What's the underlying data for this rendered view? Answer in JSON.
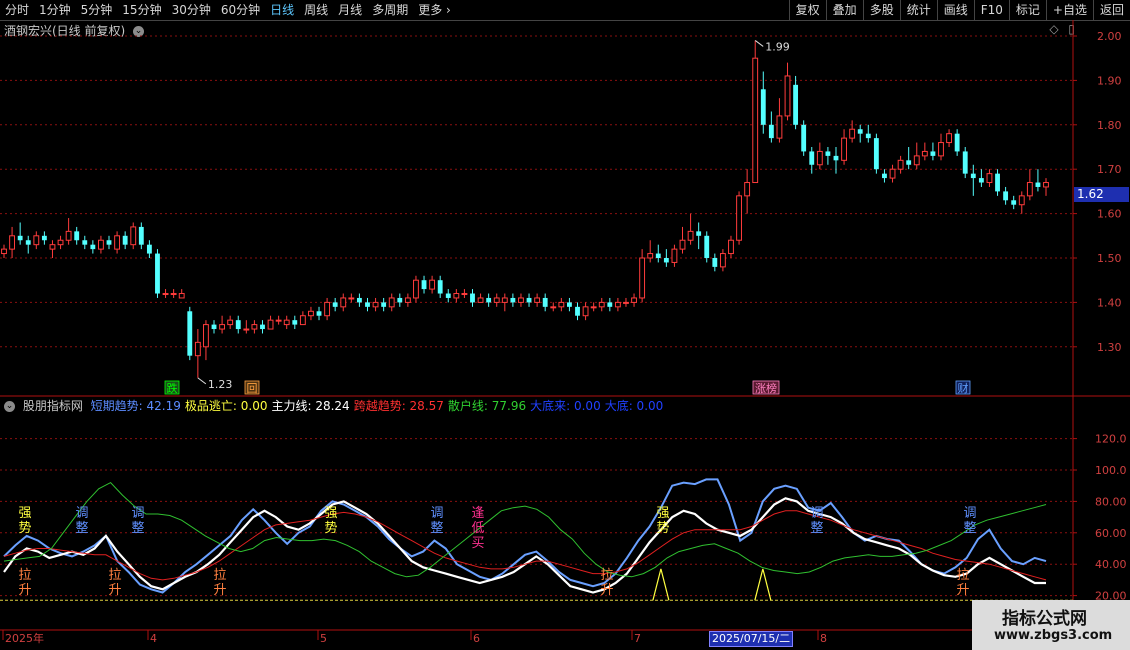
{
  "toolbar": {
    "periods": [
      "分时",
      "1分钟",
      "5分钟",
      "15分钟",
      "30分钟",
      "60分钟",
      "日线",
      "周线",
      "月线",
      "多周期",
      "更多"
    ],
    "active_period": "日线",
    "actions": [
      "复权",
      "叠加",
      "多股",
      "统计",
      "画线",
      "F10",
      "标记",
      "+自选",
      "返回"
    ]
  },
  "stock": {
    "title": "酒钢宏兴(日线 前复权)",
    "current_price": "1.62",
    "high_label": "1.99",
    "low_label": "1.23"
  },
  "price_axis": [
    "2.00",
    "1.90",
    "1.80",
    "1.70",
    "1.60",
    "1.50",
    "1.40",
    "1.30"
  ],
  "indicator_axis": [
    "120.0",
    "100.0",
    "80.00",
    "60.00",
    "40.00",
    "20.00"
  ],
  "event_markers": [
    {
      "text": "跌",
      "color": "#00ff00",
      "bg": "#1a4d1a"
    },
    {
      "text": "回",
      "color": "#ffa040",
      "bg": "#4d3311"
    },
    {
      "text": "涨榜",
      "color": "#ff80c0",
      "bg": "#5a1a30"
    },
    {
      "text": "财",
      "color": "#60a0ff",
      "bg": "#10205a"
    }
  ],
  "indicator": {
    "name": "股朋指标网",
    "items": [
      {
        "label": "短期趋势:",
        "value": "42.19",
        "color": "#5c8cff"
      },
      {
        "label": "极品逃亡:",
        "value": "0.00",
        "color": "#ffff40"
      },
      {
        "label": "主力线:",
        "value": "28.24",
        "color": "#ffffff"
      },
      {
        "label": "跨越趋势:",
        "value": "28.57",
        "color": "#ff3030"
      },
      {
        "label": "散户线:",
        "value": "77.96",
        "color": "#30d030"
      },
      {
        "label": "大底来:",
        "value": "0.00",
        "color": "#2040ff"
      },
      {
        "label": "大底:",
        "value": "0.00",
        "color": "#2040ff"
      }
    ]
  },
  "signals": [
    {
      "text": "强",
      "text2": "势",
      "color": "#ffff40",
      "x": 25,
      "y": 517
    },
    {
      "text": "调",
      "text2": "整",
      "color": "#6090ff",
      "x": 82,
      "y": 517
    },
    {
      "text": "调",
      "text2": "整",
      "color": "#6090ff",
      "x": 138,
      "y": 517
    },
    {
      "text": "强",
      "text2": "势",
      "color": "#ffff40",
      "x": 331,
      "y": 517
    },
    {
      "text": "调",
      "text2": "整",
      "color": "#6090ff",
      "x": 437,
      "y": 517
    },
    {
      "text": "逢",
      "text2": "低",
      "text3": "买",
      "color": "#ff3090",
      "x": 478,
      "y": 517
    },
    {
      "text": "强",
      "text2": "势",
      "color": "#ffff40",
      "x": 663,
      "y": 517
    },
    {
      "text": "调",
      "text2": "整",
      "color": "#6090ff",
      "x": 817,
      "y": 517
    },
    {
      "text": "调",
      "text2": "整",
      "color": "#6090ff",
      "x": 970,
      "y": 517
    },
    {
      "text": "拉",
      "text2": "升",
      "color": "#ff8040",
      "x": 25,
      "y": 579
    },
    {
      "text": "拉",
      "text2": "升",
      "color": "#ff8040",
      "x": 115,
      "y": 579
    },
    {
      "text": "拉",
      "text2": "升",
      "color": "#ff8040",
      "x": 220,
      "y": 579
    },
    {
      "text": "拉",
      "text2": "升",
      "color": "#ff8040",
      "x": 607,
      "y": 579
    },
    {
      "text": "拉",
      "text2": "升",
      "color": "#ff8040",
      "x": 963,
      "y": 579
    }
  ],
  "date_axis": {
    "labels": [
      "2025年",
      "4",
      "5",
      "6",
      "7",
      "8"
    ],
    "highlight": "2025/07/15/二"
  },
  "watermark": {
    "line1": "指标公式网",
    "line2": "www.zbgs3.com"
  },
  "colors": {
    "up": "#ff3c3c",
    "down": "#54ffff",
    "grid": "#8a1010",
    "axis": "#b01010"
  },
  "chart_data": {
    "type": "candlestick",
    "ylim": [
      1.2,
      2.05
    ],
    "candles": [
      [
        1.51,
        1.52,
        1.53,
        1.5
      ],
      [
        1.52,
        1.55,
        1.57,
        1.5
      ],
      [
        1.55,
        1.54,
        1.58,
        1.53
      ],
      [
        1.54,
        1.53,
        1.55,
        1.51
      ],
      [
        1.53,
        1.55,
        1.56,
        1.52
      ],
      [
        1.55,
        1.54,
        1.56,
        1.53
      ],
      [
        1.52,
        1.53,
        1.54,
        1.5
      ],
      [
        1.53,
        1.54,
        1.55,
        1.52
      ],
      [
        1.54,
        1.56,
        1.59,
        1.53
      ],
      [
        1.56,
        1.54,
        1.57,
        1.53
      ],
      [
        1.54,
        1.53,
        1.55,
        1.52
      ],
      [
        1.53,
        1.52,
        1.54,
        1.51
      ],
      [
        1.52,
        1.54,
        1.55,
        1.51
      ],
      [
        1.54,
        1.53,
        1.55,
        1.52
      ],
      [
        1.52,
        1.55,
        1.56,
        1.51
      ],
      [
        1.55,
        1.53,
        1.56,
        1.52
      ],
      [
        1.53,
        1.57,
        1.58,
        1.52
      ],
      [
        1.57,
        1.53,
        1.58,
        1.52
      ],
      [
        1.53,
        1.51,
        1.54,
        1.5
      ],
      [
        1.51,
        1.42,
        1.52,
        1.41
      ],
      [
        1.42,
        1.42,
        1.43,
        1.41
      ],
      [
        1.42,
        1.42,
        1.43,
        1.41
      ],
      [
        1.41,
        1.42,
        1.43,
        1.41
      ],
      [
        1.38,
        1.28,
        1.39,
        1.27
      ],
      [
        1.28,
        1.31,
        1.34,
        1.23
      ],
      [
        1.3,
        1.35,
        1.36,
        1.27
      ],
      [
        1.35,
        1.34,
        1.36,
        1.33
      ],
      [
        1.34,
        1.35,
        1.37,
        1.33
      ],
      [
        1.35,
        1.36,
        1.37,
        1.34
      ],
      [
        1.36,
        1.34,
        1.37,
        1.33
      ],
      [
        1.34,
        1.34,
        1.36,
        1.33
      ],
      [
        1.34,
        1.35,
        1.36,
        1.33
      ],
      [
        1.35,
        1.34,
        1.36,
        1.33
      ],
      [
        1.34,
        1.36,
        1.37,
        1.34
      ],
      [
        1.36,
        1.36,
        1.37,
        1.35
      ],
      [
        1.35,
        1.36,
        1.37,
        1.34
      ],
      [
        1.36,
        1.35,
        1.37,
        1.34
      ],
      [
        1.35,
        1.37,
        1.38,
        1.35
      ],
      [
        1.37,
        1.38,
        1.39,
        1.36
      ],
      [
        1.38,
        1.37,
        1.39,
        1.36
      ],
      [
        1.37,
        1.4,
        1.41,
        1.36
      ],
      [
        1.4,
        1.39,
        1.41,
        1.38
      ],
      [
        1.39,
        1.41,
        1.42,
        1.38
      ],
      [
        1.41,
        1.41,
        1.42,
        1.4
      ],
      [
        1.41,
        1.4,
        1.42,
        1.39
      ],
      [
        1.4,
        1.39,
        1.41,
        1.38
      ],
      [
        1.39,
        1.4,
        1.41,
        1.38
      ],
      [
        1.4,
        1.39,
        1.41,
        1.38
      ],
      [
        1.39,
        1.41,
        1.42,
        1.38
      ],
      [
        1.41,
        1.4,
        1.42,
        1.39
      ],
      [
        1.4,
        1.41,
        1.42,
        1.39
      ],
      [
        1.41,
        1.45,
        1.46,
        1.4
      ],
      [
        1.45,
        1.43,
        1.46,
        1.42
      ],
      [
        1.43,
        1.45,
        1.46,
        1.42
      ],
      [
        1.45,
        1.42,
        1.46,
        1.41
      ],
      [
        1.42,
        1.41,
        1.43,
        1.4
      ],
      [
        1.41,
        1.42,
        1.43,
        1.4
      ],
      [
        1.42,
        1.42,
        1.43,
        1.41
      ],
      [
        1.42,
        1.4,
        1.43,
        1.39
      ],
      [
        1.4,
        1.41,
        1.42,
        1.4
      ],
      [
        1.41,
        1.4,
        1.42,
        1.39
      ],
      [
        1.4,
        1.41,
        1.42,
        1.39
      ],
      [
        1.4,
        1.41,
        1.42,
        1.38
      ],
      [
        1.41,
        1.4,
        1.42,
        1.39
      ],
      [
        1.4,
        1.41,
        1.42,
        1.39
      ],
      [
        1.41,
        1.4,
        1.42,
        1.39
      ],
      [
        1.4,
        1.41,
        1.42,
        1.39
      ],
      [
        1.41,
        1.39,
        1.42,
        1.38
      ],
      [
        1.39,
        1.39,
        1.4,
        1.38
      ],
      [
        1.39,
        1.4,
        1.41,
        1.38
      ],
      [
        1.4,
        1.39,
        1.41,
        1.38
      ],
      [
        1.39,
        1.37,
        1.4,
        1.36
      ],
      [
        1.37,
        1.39,
        1.4,
        1.36
      ],
      [
        1.39,
        1.39,
        1.4,
        1.38
      ],
      [
        1.39,
        1.4,
        1.41,
        1.38
      ],
      [
        1.4,
        1.39,
        1.41,
        1.38
      ],
      [
        1.39,
        1.4,
        1.41,
        1.38
      ],
      [
        1.4,
        1.4,
        1.41,
        1.39
      ],
      [
        1.4,
        1.41,
        1.42,
        1.39
      ],
      [
        1.41,
        1.5,
        1.52,
        1.4
      ],
      [
        1.5,
        1.51,
        1.54,
        1.49
      ],
      [
        1.51,
        1.5,
        1.53,
        1.49
      ],
      [
        1.5,
        1.49,
        1.52,
        1.48
      ],
      [
        1.49,
        1.52,
        1.53,
        1.48
      ],
      [
        1.52,
        1.54,
        1.57,
        1.51
      ],
      [
        1.54,
        1.56,
        1.6,
        1.53
      ],
      [
        1.56,
        1.55,
        1.58,
        1.52
      ],
      [
        1.55,
        1.5,
        1.56,
        1.49
      ],
      [
        1.5,
        1.48,
        1.51,
        1.47
      ],
      [
        1.48,
        1.51,
        1.52,
        1.47
      ],
      [
        1.51,
        1.54,
        1.55,
        1.5
      ],
      [
        1.54,
        1.64,
        1.65,
        1.53
      ],
      [
        1.64,
        1.67,
        1.7,
        1.6
      ],
      [
        1.67,
        1.95,
        1.99,
        1.68
      ],
      [
        1.88,
        1.8,
        1.92,
        1.78
      ],
      [
        1.8,
        1.77,
        1.83,
        1.76
      ],
      [
        1.77,
        1.82,
        1.86,
        1.76
      ],
      [
        1.82,
        1.91,
        1.94,
        1.81
      ],
      [
        1.89,
        1.8,
        1.91,
        1.79
      ],
      [
        1.8,
        1.74,
        1.81,
        1.73
      ],
      [
        1.74,
        1.71,
        1.75,
        1.69
      ],
      [
        1.71,
        1.74,
        1.76,
        1.7
      ],
      [
        1.74,
        1.73,
        1.75,
        1.71
      ],
      [
        1.73,
        1.72,
        1.75,
        1.69
      ],
      [
        1.72,
        1.77,
        1.79,
        1.71
      ],
      [
        1.77,
        1.79,
        1.81,
        1.76
      ],
      [
        1.79,
        1.78,
        1.8,
        1.76
      ],
      [
        1.78,
        1.77,
        1.8,
        1.76
      ],
      [
        1.77,
        1.7,
        1.78,
        1.69
      ],
      [
        1.69,
        1.68,
        1.7,
        1.67
      ],
      [
        1.68,
        1.7,
        1.71,
        1.67
      ],
      [
        1.7,
        1.72,
        1.73,
        1.69
      ],
      [
        1.72,
        1.71,
        1.75,
        1.7
      ],
      [
        1.71,
        1.73,
        1.76,
        1.7
      ],
      [
        1.73,
        1.74,
        1.76,
        1.72
      ],
      [
        1.74,
        1.73,
        1.76,
        1.72
      ],
      [
        1.73,
        1.76,
        1.78,
        1.72
      ],
      [
        1.76,
        1.78,
        1.79,
        1.75
      ],
      [
        1.78,
        1.74,
        1.79,
        1.73
      ],
      [
        1.74,
        1.69,
        1.75,
        1.68
      ],
      [
        1.69,
        1.68,
        1.71,
        1.64
      ],
      [
        1.68,
        1.67,
        1.7,
        1.66
      ],
      [
        1.67,
        1.69,
        1.7,
        1.66
      ],
      [
        1.69,
        1.65,
        1.7,
        1.64
      ],
      [
        1.65,
        1.63,
        1.66,
        1.62
      ],
      [
        1.63,
        1.62,
        1.64,
        1.61
      ],
      [
        1.62,
        1.64,
        1.65,
        1.6
      ],
      [
        1.64,
        1.67,
        1.7,
        1.63
      ],
      [
        1.67,
        1.66,
        1.7,
        1.65
      ],
      [
        1.66,
        1.67,
        1.68,
        1.64
      ]
    ],
    "indicator": {
      "ylim": [
        15,
        130
      ],
      "series": [
        {
          "name": "短期趋势",
          "color": "#6aa0ff",
          "values": [
            45,
            52,
            58,
            55,
            50,
            47,
            45,
            48,
            52,
            58,
            42,
            35,
            27,
            24,
            22,
            28,
            35,
            40,
            46,
            52,
            58,
            68,
            75,
            68,
            60,
            53,
            60,
            64,
            74,
            80,
            78,
            74,
            70,
            64,
            56,
            50,
            45,
            48,
            55,
            50,
            40,
            36,
            32,
            30,
            34,
            40,
            46,
            48,
            42,
            35,
            30,
            28,
            26,
            28,
            34,
            44,
            55,
            64,
            76,
            90,
            92,
            91,
            94,
            94,
            78,
            55,
            60,
            80,
            88,
            90,
            88,
            76,
            74,
            79,
            70,
            60,
            55,
            58,
            56,
            55,
            48,
            40,
            36,
            34,
            38,
            44,
            56,
            62,
            50,
            42,
            40,
            44,
            42
          ]
        },
        {
          "name": "主力线",
          "color": "#ffffff",
          "values": [
            35,
            45,
            50,
            48,
            44,
            46,
            48,
            46,
            50,
            58,
            48,
            40,
            32,
            26,
            24,
            28,
            32,
            35,
            40,
            46,
            54,
            62,
            70,
            74,
            70,
            64,
            62,
            66,
            72,
            78,
            80,
            76,
            72,
            66,
            58,
            50,
            42,
            38,
            36,
            34,
            32,
            30,
            28,
            30,
            32,
            35,
            40,
            45,
            40,
            33,
            26,
            24,
            22,
            24,
            28,
            34,
            44,
            54,
            62,
            70,
            74,
            72,
            66,
            62,
            60,
            58,
            62,
            70,
            78,
            82,
            80,
            74,
            72,
            70,
            66,
            60,
            56,
            54,
            52,
            50,
            46,
            40,
            36,
            33,
            32,
            34,
            40,
            44,
            40,
            36,
            32,
            28,
            28
          ]
        },
        {
          "name": "跨越趋势",
          "color": "#e02020",
          "values": [
            45,
            47,
            49,
            50,
            50,
            49,
            48,
            47,
            46,
            46,
            42,
            38,
            34,
            31,
            30,
            31,
            33,
            35,
            38,
            42,
            47,
            52,
            57,
            62,
            65,
            66,
            67,
            68,
            70,
            72,
            73,
            72,
            70,
            67,
            63,
            59,
            55,
            51,
            47,
            44,
            42,
            40,
            38,
            37,
            37,
            38,
            40,
            42,
            42,
            40,
            38,
            36,
            34,
            34,
            35,
            37,
            41,
            46,
            51,
            56,
            60,
            62,
            62,
            62,
            62,
            62,
            64,
            68,
            72,
            74,
            74,
            72,
            70,
            68,
            65,
            62,
            60,
            58,
            56,
            54,
            52,
            50,
            47,
            45,
            43,
            42,
            41,
            40,
            38,
            36,
            34,
            32,
            30
          ]
        },
        {
          "name": "散户线",
          "color": "#30c030",
          "values": [
            42,
            43,
            44,
            45,
            50,
            60,
            70,
            80,
            88,
            92,
            84,
            77,
            72,
            72,
            71,
            68,
            63,
            58,
            54,
            50,
            48,
            50,
            55,
            57,
            56,
            55,
            55,
            56,
            55,
            52,
            48,
            42,
            38,
            34,
            32,
            33,
            38,
            44,
            50,
            56,
            62,
            68,
            74,
            76,
            77,
            75,
            70,
            62,
            56,
            47,
            40,
            35,
            33,
            32,
            34,
            38,
            44,
            48,
            50,
            52,
            53,
            50,
            47,
            42,
            38,
            36,
            35,
            34,
            35,
            38,
            42,
            44,
            45,
            46,
            45,
            45,
            46,
            47,
            49,
            52,
            55,
            60,
            65,
            68,
            70,
            72,
            74,
            76,
            78
          ]
        }
      ],
      "spikes": [
        {
          "index": 58,
          "value": 37
        },
        {
          "index": 67,
          "value": 37
        }
      ]
    }
  }
}
